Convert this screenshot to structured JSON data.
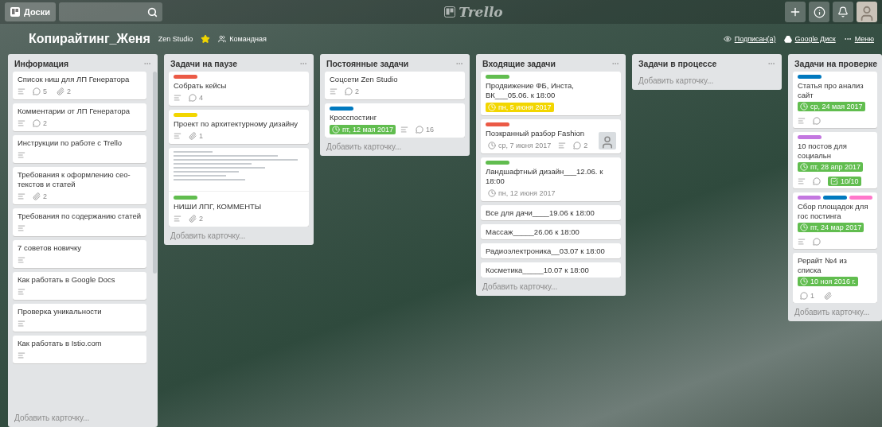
{
  "header": {
    "boards_button": "Доски",
    "logo": "Trello"
  },
  "board": {
    "title": "Копирайтинг_Женя",
    "team": "Zen Studio",
    "starred": true,
    "visibility": "Командная",
    "subscribed": "Подписан(а)",
    "drive": "Google Диск",
    "menu": "Меню"
  },
  "lists": [
    {
      "title": "Информация",
      "add_card": "Добавить карточку...",
      "cards": [
        {
          "title": "Список ниш для ЛП Генератора",
          "badges": [
            {
              "kind": "description"
            },
            {
              "kind": "comments",
              "text": "5"
            },
            {
              "kind": "attachments",
              "text": "2"
            }
          ]
        },
        {
          "title": "Комментарии от ЛП Генератора",
          "badges": [
            {
              "kind": "description"
            },
            {
              "kind": "comments",
              "text": "2"
            }
          ]
        },
        {
          "title": "Инструкции по работе с Trello",
          "badges": [
            {
              "kind": "description"
            }
          ]
        },
        {
          "title": "Требования к оформлению сео-текстов и статей",
          "badges": [
            {
              "kind": "description"
            },
            {
              "kind": "attachments",
              "text": "2"
            }
          ]
        },
        {
          "title": "Требования по содержанию статей",
          "badges": [
            {
              "kind": "description"
            }
          ]
        },
        {
          "title": "7 советов новичку",
          "badges": [
            {
              "kind": "description"
            }
          ]
        },
        {
          "title": "Как работать в Google Docs",
          "badges": [
            {
              "kind": "description"
            }
          ]
        },
        {
          "title": "Проверка уникальности",
          "badges": [
            {
              "kind": "description"
            }
          ]
        },
        {
          "title": "Как работать в Istio.com",
          "badges": [
            {
              "kind": "description"
            }
          ]
        }
      ]
    },
    {
      "title": "Задачи на паузе",
      "add_card": "Добавить карточку...",
      "cards": [
        {
          "labels": [
            {
              "color": "#eb5a46"
            }
          ],
          "title": "Собрать кейсы",
          "badges": [
            {
              "kind": "description"
            },
            {
              "kind": "comments",
              "text": "4"
            }
          ]
        },
        {
          "labels": [
            {
              "color": "#f2d600"
            }
          ],
          "title": "Проект по архитектурному дизайну",
          "badges": [
            {
              "kind": "description"
            },
            {
              "kind": "attachments",
              "text": "1"
            }
          ]
        },
        {
          "cover": true,
          "labels": [
            {
              "color": "#61bd4f"
            }
          ],
          "title": "НИШИ ЛПГ, КОММЕНТЫ",
          "badges": [
            {
              "kind": "description"
            },
            {
              "kind": "attachments",
              "text": "2"
            }
          ]
        }
      ]
    },
    {
      "title": "Постоянные задачи",
      "add_card": "Добавить карточку...",
      "cards": [
        {
          "title": "Соцсети Zen Studio",
          "badges": [
            {
              "kind": "description"
            },
            {
              "kind": "comments",
              "text": "2"
            }
          ]
        },
        {
          "labels": [
            {
              "color": "#0079bf"
            }
          ],
          "title": "Кросспостинг",
          "badges": [
            {
              "kind": "due",
              "text": "пт, 12 мая 2017",
              "color": "#61bd4f"
            },
            {
              "kind": "description"
            },
            {
              "kind": "comments",
              "text": "16"
            }
          ]
        }
      ]
    },
    {
      "title": "Входящие задачи",
      "add_card": "Добавить карточку...",
      "cards": [
        {
          "labels": [
            {
              "color": "#61bd4f"
            }
          ],
          "title": "Продвижение ФБ, Инста, ВК___05.06. к 18:00",
          "badges": [
            {
              "kind": "due",
              "text": "пн, 5 июня 2017",
              "color": "#f2d600"
            }
          ]
        },
        {
          "labels": [
            {
              "color": "#eb5a46"
            }
          ],
          "title": "Поэкранный разбор Fashion",
          "member": true,
          "badges": [
            {
              "kind": "due",
              "text": "ср, 7 июня 2017"
            },
            {
              "kind": "description"
            },
            {
              "kind": "comments",
              "text": "2"
            }
          ]
        },
        {
          "labels": [
            {
              "color": "#61bd4f"
            }
          ],
          "title": "Ландшафтный дизайн___12.06. к 18:00",
          "badges": [
            {
              "kind": "due",
              "text": "пн, 12 июня 2017"
            }
          ]
        },
        {
          "title": "Все для дачи____19.06 к 18:00"
        },
        {
          "title": "Массаж_____26.06 к 18:00"
        },
        {
          "title": "Радиоэлектроника__03.07 к 18:00"
        },
        {
          "title": "Косметика_____10.07 к 18:00"
        }
      ]
    },
    {
      "title": "Задачи в процессе",
      "add_card": "Добавить карточку..."
    },
    {
      "title": "Задачи на проверке",
      "add_card": "Добавить карточку...",
      "cards": [
        {
          "labels": [
            {
              "color": "#0079bf"
            }
          ],
          "title": "Статья про анализ сайт",
          "badges": [
            {
              "kind": "due",
              "text": "ср, 24 мая 2017",
              "color": "#61bd4f"
            },
            {
              "kind": "description"
            },
            {
              "kind": "comments"
            }
          ]
        },
        {
          "labels": [
            {
              "color": "#c377e0"
            }
          ],
          "title": "10 постов для социальн",
          "badges": [
            {
              "kind": "due",
              "text": "пт, 28 апр 2017",
              "color": "#61bd4f"
            },
            {
              "kind": "description"
            },
            {
              "kind": "comments"
            },
            {
              "kind": "checklist",
              "text": "10/10",
              "color": "#61bd4f"
            }
          ]
        },
        {
          "labels": [
            {
              "color": "#c377e0"
            },
            {
              "color": "#0079bf"
            },
            {
              "color": "#ff78cb"
            }
          ],
          "title": "Сбор площадок для гос постинга",
          "badges": [
            {
              "kind": "due",
              "text": "пт, 24 мар 2017",
              "color": "#61bd4f"
            },
            {
              "kind": "description"
            },
            {
              "kind": "comments"
            }
          ]
        },
        {
          "title": "Рерайт №4 из списка",
          "badges": [
            {
              "kind": "due",
              "text": "10 ноя 2016 г.",
              "color": "#61bd4f"
            },
            {
              "kind": "comments",
              "text": "1"
            },
            {
              "kind": "attachments"
            }
          ]
        }
      ]
    }
  ]
}
